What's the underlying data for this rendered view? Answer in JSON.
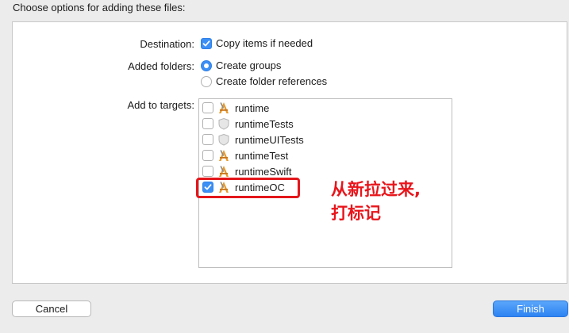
{
  "dialog": {
    "heading": "Choose options for adding these files:"
  },
  "destination": {
    "label": "Destination:",
    "copy_items": {
      "label": "Copy items if needed",
      "checked": true
    }
  },
  "added_folders": {
    "label": "Added folders:",
    "options": [
      {
        "label": "Create groups",
        "selected": true
      },
      {
        "label": "Create folder references",
        "selected": false
      }
    ]
  },
  "targets": {
    "label": "Add to targets:",
    "items": [
      {
        "label": "runtime",
        "checked": false,
        "icon": "app-target-icon"
      },
      {
        "label": "runtimeTests",
        "checked": false,
        "icon": "test-target-icon"
      },
      {
        "label": "runtimeUITests",
        "checked": false,
        "icon": "test-target-icon"
      },
      {
        "label": "runtimeTest",
        "checked": false,
        "icon": "app-target-icon"
      },
      {
        "label": "runtimeSwift",
        "checked": false,
        "icon": "app-target-icon"
      },
      {
        "label": "runtimeOC",
        "checked": true,
        "icon": "app-target-icon"
      }
    ]
  },
  "annotation": {
    "line1": "从新拉过来,",
    "line2": "打标记",
    "color": "#e8151b"
  },
  "buttons": {
    "cancel": "Cancel",
    "finish": "Finish"
  },
  "colors": {
    "accent": "#3b8ff5",
    "highlight": "#e3171b"
  }
}
